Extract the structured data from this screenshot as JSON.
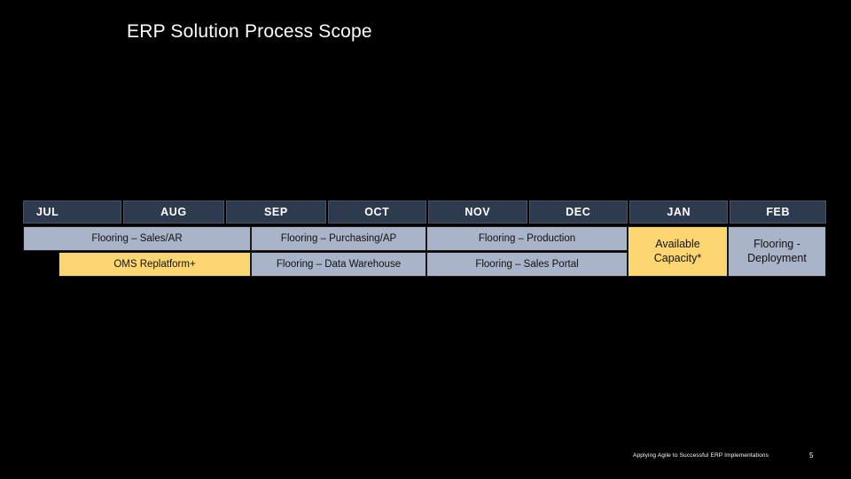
{
  "slide": {
    "title": "ERP Solution Process Scope",
    "background_color": "#000000"
  },
  "colors": {
    "header_navy": "#2e3b4e",
    "bar_blue": "#aab4c8",
    "bar_yellow": "#fcd670",
    "title_text": "#ffffff"
  },
  "timeline": {
    "months": [
      {
        "label": "JUL"
      },
      {
        "label": "AUG"
      },
      {
        "label": "SEP"
      },
      {
        "label": "OCT"
      },
      {
        "label": "NOV"
      },
      {
        "label": "DEC"
      },
      {
        "label": "JAN"
      },
      {
        "label": "FEB"
      }
    ],
    "row_1": [
      {
        "label": "Flooring – Sales/AR",
        "color": "blue"
      },
      {
        "label": "Flooring – Purchasing/AP",
        "color": "blue"
      },
      {
        "label": "Flooring – Production",
        "color": "blue"
      }
    ],
    "row_2": [
      {
        "label": "OMS Replatform+",
        "color": "yellow"
      },
      {
        "label": "Flooring – Data Warehouse",
        "color": "blue"
      },
      {
        "label": "Flooring – Sales Portal",
        "color": "blue"
      }
    ],
    "spanning": [
      {
        "label_line_1": "Available",
        "label_line_2": "Capacity*",
        "color": "yellow"
      },
      {
        "label_line_1": "Flooring -",
        "label_line_2": "Deployment",
        "color": "blue"
      }
    ]
  },
  "footer": {
    "note": "Applying Agile to Successful ERP Implementations",
    "page_number": "5"
  }
}
